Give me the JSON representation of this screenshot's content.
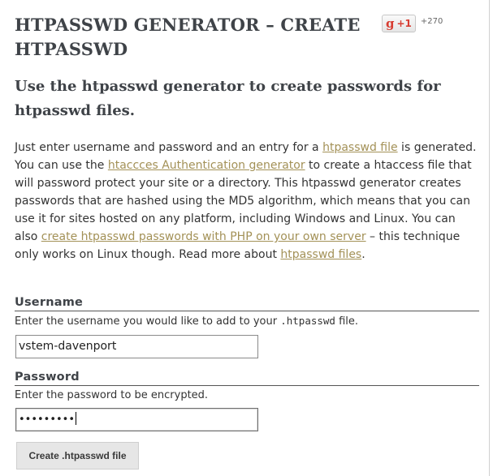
{
  "header": {
    "title": "HTPASSWD GENERATOR – CREATE HTPASSWD",
    "gplus": {
      "g_glyph": "g",
      "plus_label": "+1",
      "count": "+270",
      "accent": "#d73d32"
    }
  },
  "subtitle": "Use the htpasswd generator to create passwords for htpasswd files.",
  "intro": {
    "t1": "Just enter username and password and an entry for a ",
    "link1": "htpasswd file",
    "t2": " is generated. You can use the ",
    "link2": "htaccces Authentication generator",
    "t3": " to create a htaccess file that will password protect your site or a directory. This htpasswd generator creates passwords that are hashed using the MD5 algorithm, which means that you can use it for sites hosted on any platform, including Windows and Linux. You can also ",
    "link3": "create htpasswd passwords with PHP on your own server",
    "t4": " – this technique only works on Linux though. Read more about ",
    "link4": "htpasswd files",
    "t5": ".",
    "link_color": "#a39157"
  },
  "form": {
    "username": {
      "label": "Username",
      "help_before": "Enter the username you would like to add to your ",
      "help_code": ".htpasswd",
      "help_after": " file.",
      "value": "vstem-davenport"
    },
    "password": {
      "label": "Password",
      "help": "Enter the password to be encrypted.",
      "masked_value": "•••••••••"
    },
    "submit_label": "Create .htpasswd file"
  }
}
